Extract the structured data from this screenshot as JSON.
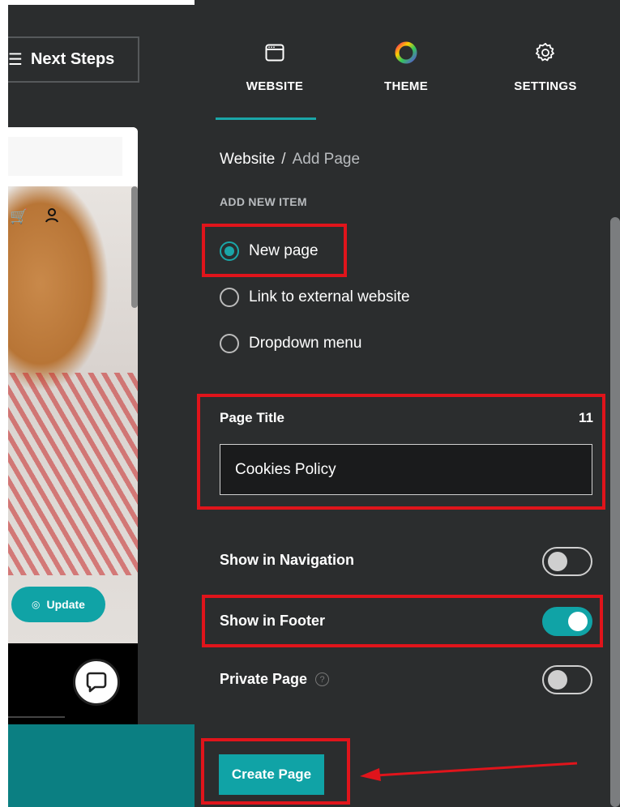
{
  "header": {
    "next_steps_label": "Next Steps"
  },
  "preview": {
    "update_label": "Update"
  },
  "tabs": [
    {
      "label": "WEBSITE",
      "icon": "browser-window-icon",
      "active": true
    },
    {
      "label": "THEME",
      "icon": "color-wheel-icon",
      "active": false
    },
    {
      "label": "SETTINGS",
      "icon": "gear-icon",
      "active": false
    }
  ],
  "breadcrumb": {
    "root": "Website",
    "separator": "/",
    "current": "Add Page"
  },
  "add_item": {
    "section_label": "ADD NEW ITEM",
    "options": [
      {
        "label": "New page",
        "selected": true
      },
      {
        "label": "Link to external website",
        "selected": false
      },
      {
        "label": "Dropdown menu",
        "selected": false
      }
    ]
  },
  "page_title": {
    "label": "Page Title",
    "count": "11",
    "value": "Cookies Policy"
  },
  "toggles": {
    "show_in_navigation": {
      "label": "Show in Navigation",
      "on": false
    },
    "show_in_footer": {
      "label": "Show in Footer",
      "on": true
    },
    "private_page": {
      "label": "Private Page",
      "on": false
    }
  },
  "create_button_label": "Create Page",
  "colors": {
    "accent": "#10a3a6",
    "panel_bg": "#2b2d2e",
    "annotation": "#e0141b"
  }
}
